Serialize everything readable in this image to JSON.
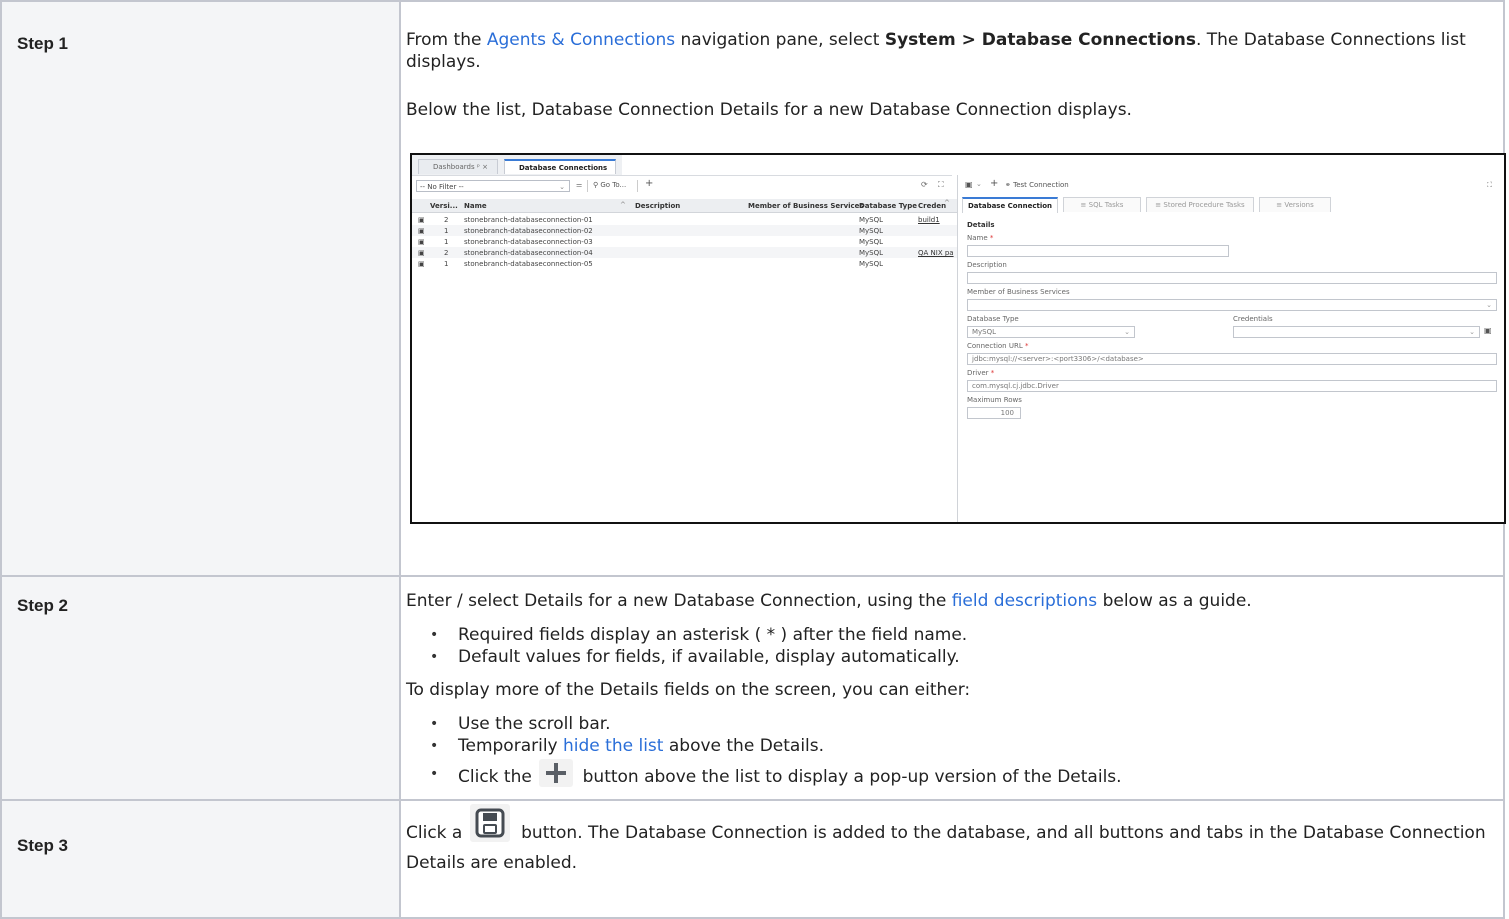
{
  "steps": [
    {
      "label": "Step 1",
      "text1_a": "From the ",
      "text1_link": "Agents & Connections",
      "text1_b": " navigation pane, select ",
      "text1_bold": "System > Database Connections",
      "text1_c": ". The Database Connections list displays.",
      "text2": "Below the list, Database Connection Details for a new Database Connection displays."
    },
    {
      "label": "Step 2",
      "intro_a": "Enter / select Details for a new Database Connection, using the ",
      "intro_link": "field descriptions",
      "intro_b": " below as a guide.",
      "bullets1": [
        "Required fields display an asterisk ( * ) after the field name.",
        "Default values for fields, if available, display automatically."
      ],
      "more": "To display more of the Details fields on the screen, you can either:",
      "bullet_scroll": "Use the scroll bar.",
      "bullet_hide_a": "Temporarily ",
      "bullet_hide_link": "hide the list",
      "bullet_hide_b": " above the Details.",
      "bullet_click_a": "Click the ",
      "bullet_click_b": " button above the list to display a pop-up version of the Details."
    },
    {
      "label": "Step 3",
      "text_a": "Click a ",
      "text_b": " button. The Database Connection is added to the database, and all buttons and tabs in the Database Connection Details are enabled."
    }
  ],
  "screenshot": {
    "tabs": [
      "Dashboards",
      "Database Connections"
    ],
    "filter": "-- No Filter --",
    "goto": "Go To...",
    "columns": [
      "Versi...",
      "Name",
      "Description",
      "Member of Business Services",
      "Database Type",
      "Creden"
    ],
    "rows": [
      {
        "version": "2",
        "name": "stonebranch-databaseconnection-01",
        "type": "MySQL",
        "cred": "build1"
      },
      {
        "version": "1",
        "name": "stonebranch-databaseconnection-02",
        "type": "MySQL",
        "cred": ""
      },
      {
        "version": "1",
        "name": "stonebranch-databaseconnection-03",
        "type": "MySQL",
        "cred": ""
      },
      {
        "version": "2",
        "name": "stonebranch-databaseconnection-04",
        "type": "MySQL",
        "cred": "QA NIX pa"
      },
      {
        "version": "1",
        "name": "stonebranch-databaseconnection-05",
        "type": "MySQL",
        "cred": ""
      }
    ],
    "test_connection": "Test Connection",
    "detail_tabs": [
      "Database Connection",
      "SQL Tasks",
      "Stored Procedure Tasks",
      "Versions"
    ],
    "details_heading": "Details",
    "labels": {
      "name": "Name",
      "description": "Description",
      "member": "Member of Business Services",
      "db_type": "Database Type",
      "credentials": "Credentials",
      "url": "Connection URL",
      "driver": "Driver",
      "max_rows": "Maximum Rows"
    },
    "values": {
      "db_type": "MySQL",
      "url": "jdbc:mysql://<server>:<port3306>/<database>",
      "driver": "com.mysql.cj.jdbc.Driver",
      "max_rows": "100"
    },
    "asterisk": "*"
  },
  "colors": {
    "link": "#2a6ed8",
    "border": "#c3c6cf",
    "label_bg": "#f4f5f7",
    "accent": "#3a7bd5"
  }
}
